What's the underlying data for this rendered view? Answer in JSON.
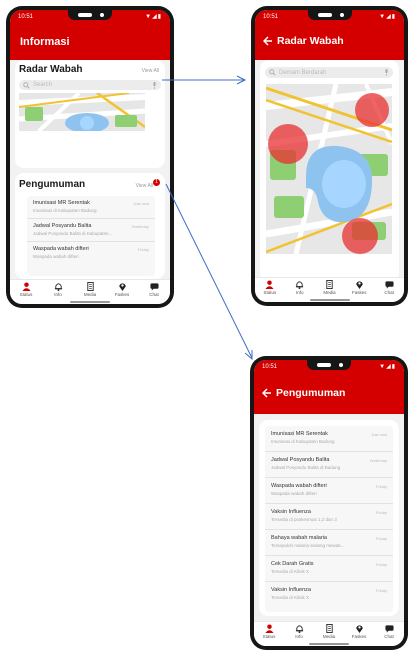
{
  "status_time": "10:51",
  "status_icons": "▼◢▮",
  "screen1": {
    "title": "Informasi",
    "radar": {
      "title": "Radar Wabah",
      "view_all": "View All",
      "search_placeholder": "Search"
    },
    "pengumuman": {
      "title": "Pengumuman",
      "view_all": "View All",
      "badge": "1",
      "items": [
        {
          "title": "Imunisasi MR Serentak",
          "subtitle": "Imunisasi di Kabupaten Badung",
          "date": "Just now"
        },
        {
          "title": "Jadwal Posyandu Balita",
          "subtitle": "Jadwal Posyandu Balita di Kabupaten...",
          "date": "Yesterday"
        },
        {
          "title": "Waspada wabah difteri",
          "subtitle": "Waspada wabah difteri",
          "date": "Friday"
        }
      ]
    }
  },
  "screen2": {
    "title": "Radar Wabah",
    "search_placeholder": "Demam Berdarah"
  },
  "screen3": {
    "title": "Pengumuman",
    "items": [
      {
        "title": "Imunisasi MR Serentak",
        "subtitle": "Imunisasi di Kabupaten Badung",
        "date": "Just now"
      },
      {
        "title": "Jadwal Posyandu Balita",
        "subtitle": "Jadwal Posyandu Balita di Badung",
        "date": "Yesterday"
      },
      {
        "title": "Waspada wabah difteri",
        "subtitle": "Waspada wabah difteri",
        "date": "Friday"
      },
      {
        "title": "Vaksin Influenza",
        "subtitle": "Tersedia di puskesmas 1,2 dan 3",
        "date": "Friday"
      },
      {
        "title": "Bahaya wabah malaria",
        "subtitle": "Tersepuluh malaria sedang mewab...",
        "date": "Friday"
      },
      {
        "title": "Cek Darah Gratis",
        "subtitle": "Tersedia di Klinik X",
        "date": "Friday"
      },
      {
        "title": "Vaksin Influenza",
        "subtitle": "Tersedia di Klinik X",
        "date": "Friday"
      }
    ]
  },
  "nav": [
    "Status",
    "Info",
    "Media",
    "Faskes",
    "Chat"
  ],
  "colors": {
    "primary": "#d40000",
    "outbreak_marker": "#e83030",
    "arrow": "#3b6fc4"
  }
}
